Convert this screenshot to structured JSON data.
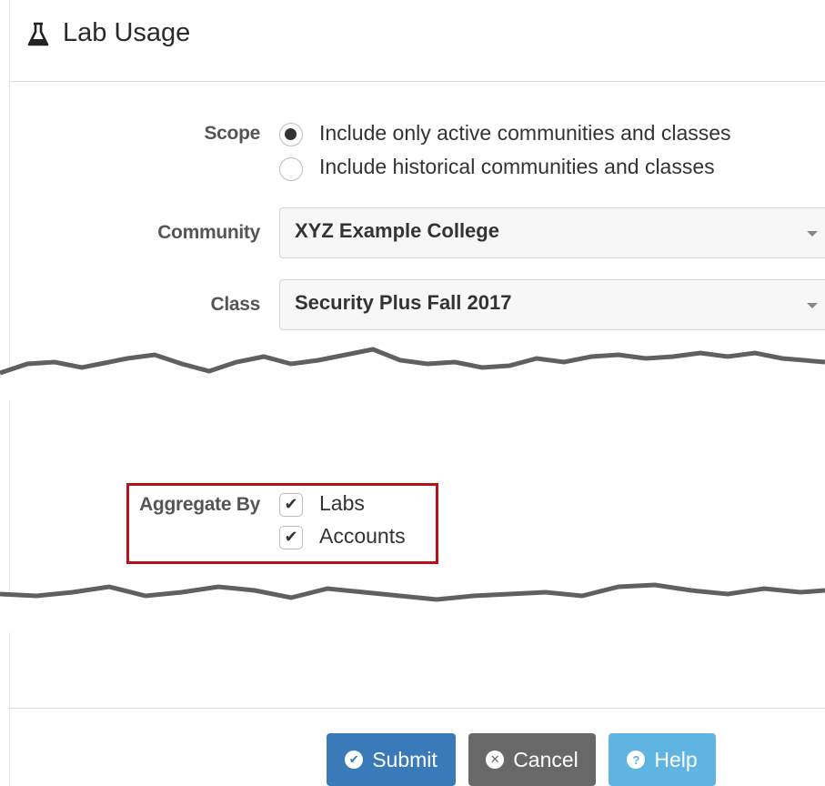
{
  "window": {
    "title": "Lab Usage",
    "icon": "flask-icon"
  },
  "form": {
    "scope": {
      "label": "Scope",
      "options": [
        {
          "label": "Include only active communities and classes",
          "selected": true
        },
        {
          "label": "Include historical communities and classes",
          "selected": false
        }
      ]
    },
    "community": {
      "label": "Community",
      "value": "XYZ Example College"
    },
    "class": {
      "label": "Class",
      "value": "Security Plus Fall 2017"
    },
    "aggregate_by": {
      "label": "Aggregate By",
      "options": [
        {
          "label": "Labs",
          "checked": true
        },
        {
          "label": "Accounts",
          "checked": true
        }
      ]
    }
  },
  "buttons": {
    "submit": {
      "label": "Submit",
      "icon": "check-circle-icon"
    },
    "cancel": {
      "label": "Cancel",
      "icon": "x-circle-icon"
    },
    "help": {
      "label": "Help",
      "icon": "question-circle-icon"
    }
  },
  "colors": {
    "highlight_border": "#b5121b",
    "submit": "#3a7ab8",
    "cancel": "#686868",
    "help": "#5fb4e2"
  }
}
